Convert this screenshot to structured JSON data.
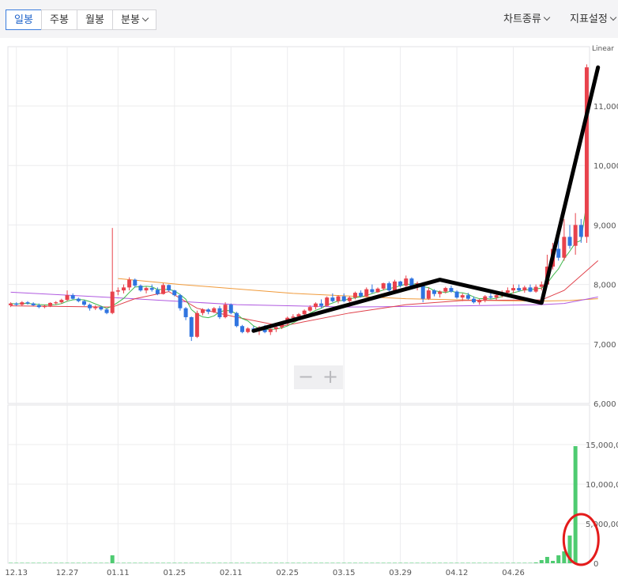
{
  "toolbar": {
    "tabs": [
      {
        "label": "일봉",
        "active": true
      },
      {
        "label": "주봉",
        "active": false
      },
      {
        "label": "월봉",
        "active": false
      },
      {
        "label": "분봉",
        "active": false
      }
    ],
    "chart_type_label": "차트종류",
    "indicator_label": "지표설정"
  },
  "zoom": {
    "minus": "−",
    "plus": "+"
  },
  "chart_data": {
    "type": "candlestick",
    "scale_label": "Linear",
    "price_ticks": [
      "11,000",
      "10,000",
      "9,000",
      "8,000",
      "7,000",
      "6,000"
    ],
    "price_tick_values": [
      11000,
      10000,
      9000,
      8000,
      7000,
      6000
    ],
    "price_range": [
      6000,
      12000
    ],
    "volume_ticks": [
      "15,000,0",
      "10,000,0",
      "5,000,00",
      "0"
    ],
    "volume_tick_values": [
      15000000,
      10000000,
      5000000,
      0
    ],
    "volume_range": [
      0,
      20000000
    ],
    "date_ticks": [
      "12.13",
      "12.27",
      "01.11",
      "01.25",
      "02.11",
      "02.25",
      "03.15",
      "03.29",
      "04.12",
      "04.26"
    ],
    "colors": {
      "up": "#e8424c",
      "down": "#2f74e0",
      "volume": "#4ecb71",
      "ma5": "#3db84a",
      "ma20": "#e0404a",
      "ma60": "#f09a3a",
      "ma120": "#b05ae0",
      "annotation": "#000000",
      "circle": "#e41b1b",
      "grid": "#ececee"
    },
    "candles": [
      [
        7650,
        7700,
        7620,
        7680
      ],
      [
        7680,
        7700,
        7640,
        7660
      ],
      [
        7660,
        7720,
        7640,
        7700
      ],
      [
        7700,
        7720,
        7660,
        7680
      ],
      [
        7680,
        7700,
        7640,
        7650
      ],
      [
        7650,
        7680,
        7600,
        7620
      ],
      [
        7620,
        7660,
        7600,
        7640
      ],
      [
        7640,
        7700,
        7620,
        7690
      ],
      [
        7690,
        7720,
        7660,
        7700
      ],
      [
        7700,
        7760,
        7680,
        7740
      ],
      [
        7740,
        7900,
        7720,
        7820
      ],
      [
        7820,
        7850,
        7750,
        7760
      ],
      [
        7760,
        7780,
        7700,
        7720
      ],
      [
        7720,
        7740,
        7640,
        7660
      ],
      [
        7660,
        7680,
        7560,
        7600
      ],
      [
        7600,
        7650,
        7570,
        7620
      ],
      [
        7620,
        7640,
        7560,
        7580
      ],
      [
        7580,
        7600,
        7500,
        7520
      ],
      [
        7520,
        8950,
        7500,
        7880
      ],
      [
        7880,
        7950,
        7820,
        7900
      ],
      [
        7900,
        8000,
        7850,
        7950
      ],
      [
        7950,
        8120,
        7900,
        8080
      ],
      [
        8080,
        8100,
        7950,
        7980
      ],
      [
        7980,
        8000,
        7880,
        7900
      ],
      [
        7900,
        7960,
        7850,
        7940
      ],
      [
        7940,
        8000,
        7880,
        7910
      ],
      [
        7910,
        7950,
        7820,
        7840
      ],
      [
        7840,
        8020,
        7830,
        7990
      ],
      [
        7990,
        8000,
        7880,
        7900
      ],
      [
        7900,
        7910,
        7800,
        7820
      ],
      [
        7820,
        7840,
        7560,
        7600
      ],
      [
        7600,
        7620,
        7400,
        7450
      ],
      [
        7450,
        7460,
        7050,
        7120
      ],
      [
        7120,
        7560,
        7100,
        7520
      ],
      [
        7520,
        7600,
        7480,
        7580
      ],
      [
        7580,
        7600,
        7500,
        7540
      ],
      [
        7540,
        7620,
        7520,
        7600
      ],
      [
        7600,
        7640,
        7420,
        7450
      ],
      [
        7450,
        7700,
        7430,
        7660
      ],
      [
        7660,
        7680,
        7500,
        7520
      ],
      [
        7520,
        7540,
        7280,
        7300
      ],
      [
        7300,
        7320,
        7180,
        7200
      ],
      [
        7200,
        7280,
        7180,
        7260
      ],
      [
        7260,
        7300,
        7200,
        7240
      ],
      [
        7240,
        7300,
        7150,
        7280
      ],
      [
        7280,
        7320,
        7180,
        7200
      ],
      [
        7200,
        7260,
        7150,
        7250
      ],
      [
        7250,
        7300,
        7200,
        7280
      ],
      [
        7280,
        7360,
        7250,
        7340
      ],
      [
        7340,
        7460,
        7320,
        7440
      ],
      [
        7440,
        7500,
        7400,
        7460
      ],
      [
        7460,
        7520,
        7420,
        7500
      ],
      [
        7500,
        7580,
        7480,
        7560
      ],
      [
        7560,
        7650,
        7540,
        7620
      ],
      [
        7620,
        7700,
        7580,
        7680
      ],
      [
        7680,
        7750,
        7600,
        7640
      ],
      [
        7640,
        7800,
        7630,
        7780
      ],
      [
        7780,
        7850,
        7700,
        7720
      ],
      [
        7720,
        7820,
        7680,
        7800
      ],
      [
        7800,
        7850,
        7700,
        7720
      ],
      [
        7720,
        7800,
        7680,
        7780
      ],
      [
        7780,
        7880,
        7750,
        7860
      ],
      [
        7860,
        7900,
        7780,
        7800
      ],
      [
        7800,
        7950,
        7790,
        7920
      ],
      [
        7920,
        8000,
        7850,
        7870
      ],
      [
        7870,
        7950,
        7860,
        7930
      ],
      [
        7930,
        8030,
        7900,
        8020
      ],
      [
        8020,
        8050,
        7880,
        7900
      ],
      [
        7900,
        8080,
        7880,
        8050
      ],
      [
        8050,
        8060,
        7950,
        7980
      ],
      [
        7980,
        8150,
        7960,
        8100
      ],
      [
        8100,
        8120,
        7920,
        7950
      ],
      [
        7950,
        8050,
        7900,
        8020
      ],
      [
        8020,
        8040,
        7700,
        7760
      ],
      [
        7760,
        7950,
        7740,
        7900
      ],
      [
        7900,
        7920,
        7800,
        7840
      ],
      [
        7840,
        7900,
        7780,
        7880
      ],
      [
        7880,
        7960,
        7850,
        7940
      ],
      [
        7940,
        7980,
        7860,
        7880
      ],
      [
        7880,
        7900,
        7760,
        7780
      ],
      [
        7780,
        7850,
        7720,
        7820
      ],
      [
        7820,
        7860,
        7740,
        7760
      ],
      [
        7760,
        7800,
        7680,
        7700
      ],
      [
        7700,
        7760,
        7660,
        7740
      ],
      [
        7740,
        7820,
        7700,
        7800
      ],
      [
        7800,
        7860,
        7760,
        7780
      ],
      [
        7780,
        7850,
        7740,
        7820
      ],
      [
        7820,
        7900,
        7780,
        7860
      ],
      [
        7860,
        7950,
        7820,
        7900
      ],
      [
        7900,
        8000,
        7850,
        7940
      ],
      [
        7940,
        8000,
        7880,
        7900
      ],
      [
        7900,
        7980,
        7860,
        7950
      ],
      [
        7950,
        8000,
        7870,
        7880
      ],
      [
        7880,
        8000,
        7860,
        7960
      ],
      [
        7960,
        8050,
        7900,
        8000
      ],
      [
        8000,
        8500,
        7980,
        8300
      ],
      [
        8300,
        8700,
        8250,
        8600
      ],
      [
        8600,
        8900,
        8400,
        8450
      ],
      [
        8450,
        9100,
        8400,
        8800
      ],
      [
        8800,
        9000,
        8600,
        8650
      ],
      [
        8650,
        9200,
        8500,
        9000
      ],
      [
        9000,
        9100,
        8700,
        8800
      ],
      [
        8800,
        11700,
        8700,
        11650
      ]
    ],
    "volumes": [
      0.05,
      0.05,
      0.05,
      0.05,
      0.05,
      0.05,
      0.05,
      0.05,
      0.05,
      0.05,
      0.05,
      0.05,
      0.05,
      0.05,
      0.05,
      0.05,
      0.05,
      0.05,
      1.0,
      0.05,
      0.05,
      0.05,
      0.05,
      0.05,
      0.05,
      0.05,
      0.05,
      0.05,
      0.05,
      0.05,
      0.05,
      0.05,
      0.05,
      0.05,
      0.05,
      0.05,
      0.05,
      0.05,
      0.05,
      0.05,
      0.05,
      0.05,
      0.05,
      0.05,
      0.05,
      0.05,
      0.05,
      0.05,
      0.05,
      0.05,
      0.05,
      0.05,
      0.05,
      0.05,
      0.05,
      0.05,
      0.05,
      0.05,
      0.05,
      0.05,
      0.05,
      0.05,
      0.05,
      0.05,
      0.05,
      0.05,
      0.05,
      0.05,
      0.05,
      0.05,
      0.05,
      0.05,
      0.05,
      0.05,
      0.05,
      0.05,
      0.05,
      0.05,
      0.05,
      0.05,
      0.05,
      0.05,
      0.05,
      0.05,
      0.05,
      0.05,
      0.05,
      0.05,
      0.05,
      0.05,
      0.05,
      0.05,
      0.05,
      0.1,
      0.4,
      0.8,
      0.3,
      1.0,
      1.5,
      3.5,
      14.8
    ],
    "volume_unit": "millions",
    "moving_averages": {
      "ma60": [
        [
          19,
          8100
        ],
        [
          30,
          8000
        ],
        [
          50,
          7850
        ],
        [
          70,
          7760
        ],
        [
          85,
          7730
        ],
        [
          94,
          7720
        ],
        [
          99,
          7730
        ],
        [
          104,
          7760
        ]
      ],
      "ma120": [
        [
          0,
          7870
        ],
        [
          18,
          7780
        ],
        [
          40,
          7660
        ],
        [
          60,
          7620
        ],
        [
          80,
          7640
        ],
        [
          94,
          7660
        ],
        [
          98,
          7680
        ],
        [
          104,
          7790
        ]
      ],
      "ma20": [
        [
          0,
          7640
        ],
        [
          18,
          7620
        ],
        [
          22,
          7760
        ],
        [
          28,
          7880
        ],
        [
          33,
          7600
        ],
        [
          40,
          7450
        ],
        [
          48,
          7300
        ],
        [
          60,
          7520
        ],
        [
          70,
          7660
        ],
        [
          80,
          7730
        ],
        [
          94,
          7740
        ],
        [
          98,
          7900
        ],
        [
          104,
          8400
        ]
      ]
    },
    "annotation_polyline": [
      [
        7220,
        43
      ],
      [
        8080,
        76
      ],
      [
        7690,
        94
      ],
      [
        11650,
        104
      ]
    ],
    "annotation_circle_around_last_volume": true
  }
}
